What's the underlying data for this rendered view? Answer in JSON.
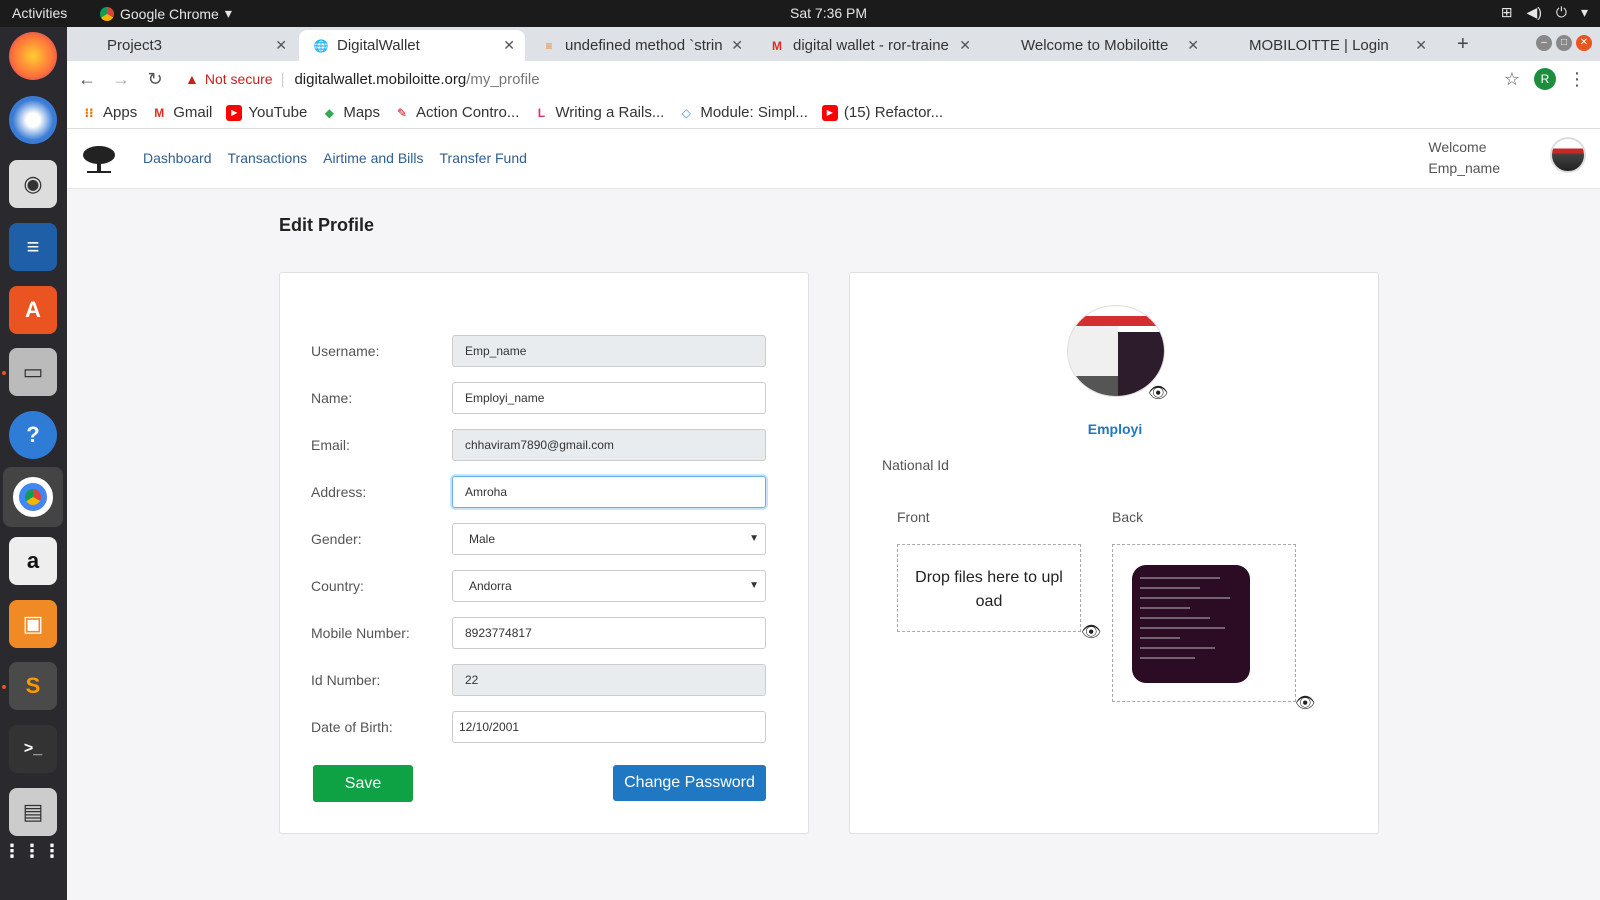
{
  "topbar": {
    "activities": "Activities",
    "app_name": "Google Chrome",
    "clock": "Sat  7:36 PM"
  },
  "tabs": [
    {
      "title": "Project3"
    },
    {
      "title": "DigitalWallet"
    },
    {
      "title": "undefined method `strin"
    },
    {
      "title": "digital wallet - ror-traine"
    },
    {
      "title": "Welcome to Mobiloitte"
    },
    {
      "title": "MOBILOITTE | Login"
    }
  ],
  "omnibox": {
    "security": "Not secure",
    "host": "digitalwallet.mobiloitte.org",
    "path": "/my_profile",
    "profile_initial": "R"
  },
  "bookmarks": [
    {
      "label": "Apps"
    },
    {
      "label": "Gmail"
    },
    {
      "label": "YouTube"
    },
    {
      "label": "Maps"
    },
    {
      "label": "Action Contro..."
    },
    {
      "label": "Writing a Rails..."
    },
    {
      "label": "Module: Simpl..."
    },
    {
      "label": "(15) Refactor..."
    }
  ],
  "site": {
    "nav": [
      "Dashboard",
      "Transactions",
      "Airtime and Bills",
      "Transfer Fund"
    ],
    "welcome_line1": "Welcome",
    "welcome_line2": "Emp_name"
  },
  "page_title": "Edit Profile",
  "form": {
    "username": {
      "label": "Username:",
      "value": "Emp_name"
    },
    "name": {
      "label": "Name:",
      "value": "Employi_name"
    },
    "email": {
      "label": "Email:",
      "value": "chhaviram7890@gmail.com"
    },
    "address": {
      "label": "Address:",
      "value": "Amroha"
    },
    "gender": {
      "label": "Gender:",
      "value": "Male"
    },
    "country": {
      "label": "Country:",
      "value": "Andorra"
    },
    "mobile": {
      "label": "Mobile Number:",
      "value": "8923774817"
    },
    "id_number": {
      "label": "Id Number:",
      "value": "22"
    },
    "dob": {
      "label": "Date of Birth:",
      "value": "12/10/2001"
    },
    "save_label": "Save",
    "change_password_label": "Change Password"
  },
  "photo": {
    "name": "Employi",
    "national_id": "National Id",
    "front": "Front",
    "back": "Back",
    "dropzone": "Drop files here to upload"
  },
  "colors": {
    "save_button": "#0ea244",
    "change_password_button": "#1f78c1",
    "nav_link": "#2f5f8f"
  }
}
